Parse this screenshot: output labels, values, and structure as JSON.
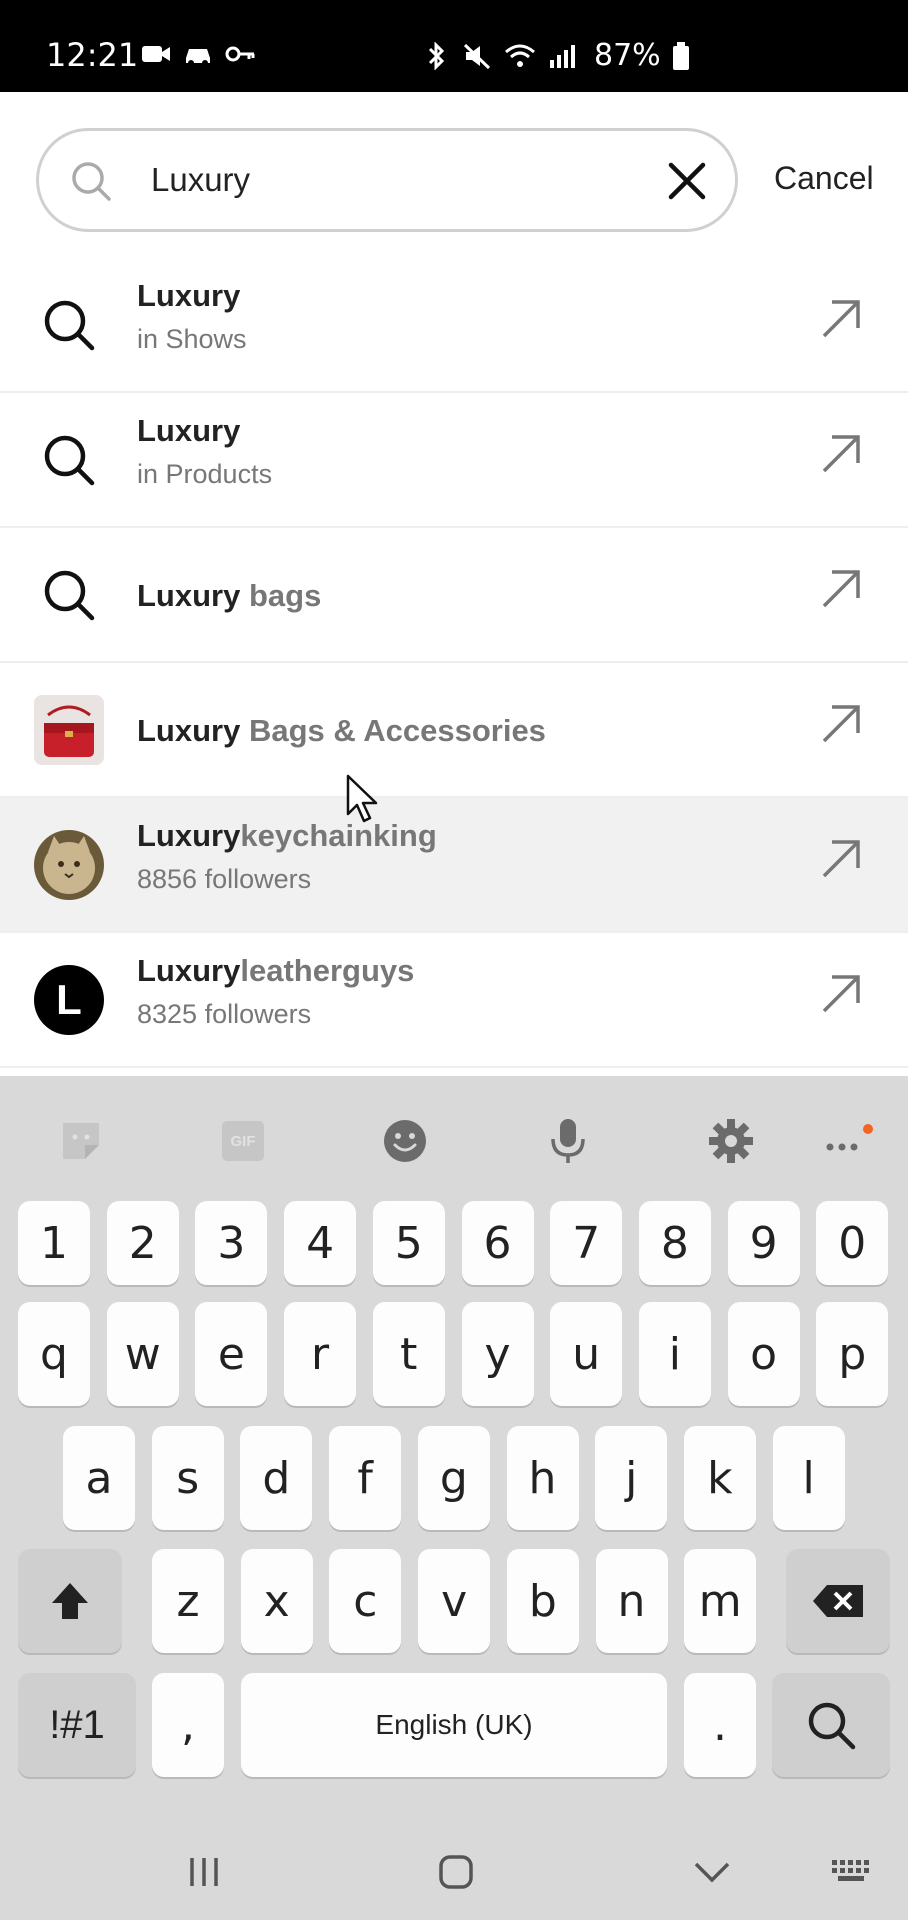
{
  "status_bar": {
    "time": "12:21",
    "battery": "87%",
    "icons": [
      "video-icon",
      "car-icon",
      "key-icon",
      "bluetooth-icon",
      "mute-icon",
      "wifi-icon",
      "signal-icon",
      "battery-icon"
    ]
  },
  "search": {
    "query": "Luxury",
    "cancel_label": "Cancel"
  },
  "results": [
    {
      "type": "search",
      "icon": "search-icon",
      "title_bold": "Luxury",
      "title_muted": "",
      "subtitle": "in Shows"
    },
    {
      "type": "search",
      "icon": "search-icon",
      "title_bold": "Luxury",
      "title_muted": "",
      "subtitle": "in Products"
    },
    {
      "type": "search",
      "icon": "search-icon",
      "title_bold": "Luxury",
      "title_muted": " bags",
      "subtitle": ""
    },
    {
      "type": "category",
      "icon": "red-bag-thumbnail",
      "title_bold": "Luxury",
      "title_muted": " Bags & Accessories",
      "subtitle": ""
    },
    {
      "type": "user",
      "icon": "cat-avatar",
      "title_bold": "Luxury",
      "title_muted": "keychainking",
      "subtitle": "8856 followers"
    },
    {
      "type": "user",
      "icon": "letter-l-avatar",
      "avatar_letter": "L",
      "title_bold": "Luxury",
      "title_muted": "leatherguys",
      "subtitle": "8325 followers"
    }
  ],
  "keyboard": {
    "toolbar": [
      "sticker-icon",
      "gif-icon",
      "emoji-icon",
      "microphone-icon",
      "settings-gear-icon",
      "more-icon"
    ],
    "gif_label": "GIF",
    "row_numbers": [
      "1",
      "2",
      "3",
      "4",
      "5",
      "6",
      "7",
      "8",
      "9",
      "0"
    ],
    "row_top": [
      "q",
      "w",
      "e",
      "r",
      "t",
      "y",
      "u",
      "i",
      "o",
      "p"
    ],
    "row_middle": [
      "a",
      "s",
      "d",
      "f",
      "g",
      "h",
      "j",
      "k",
      "l"
    ],
    "row_bottom": [
      "z",
      "x",
      "c",
      "v",
      "b",
      "n",
      "m"
    ],
    "symbols_label": "!#1",
    "comma_label": ",",
    "space_label": "English (UK)",
    "period_label": ".",
    "accent_color": "#f26522"
  },
  "nav_bar": {
    "icons": [
      "recent-apps-icon",
      "home-icon",
      "back-icon",
      "keyboard-switch-icon"
    ]
  }
}
